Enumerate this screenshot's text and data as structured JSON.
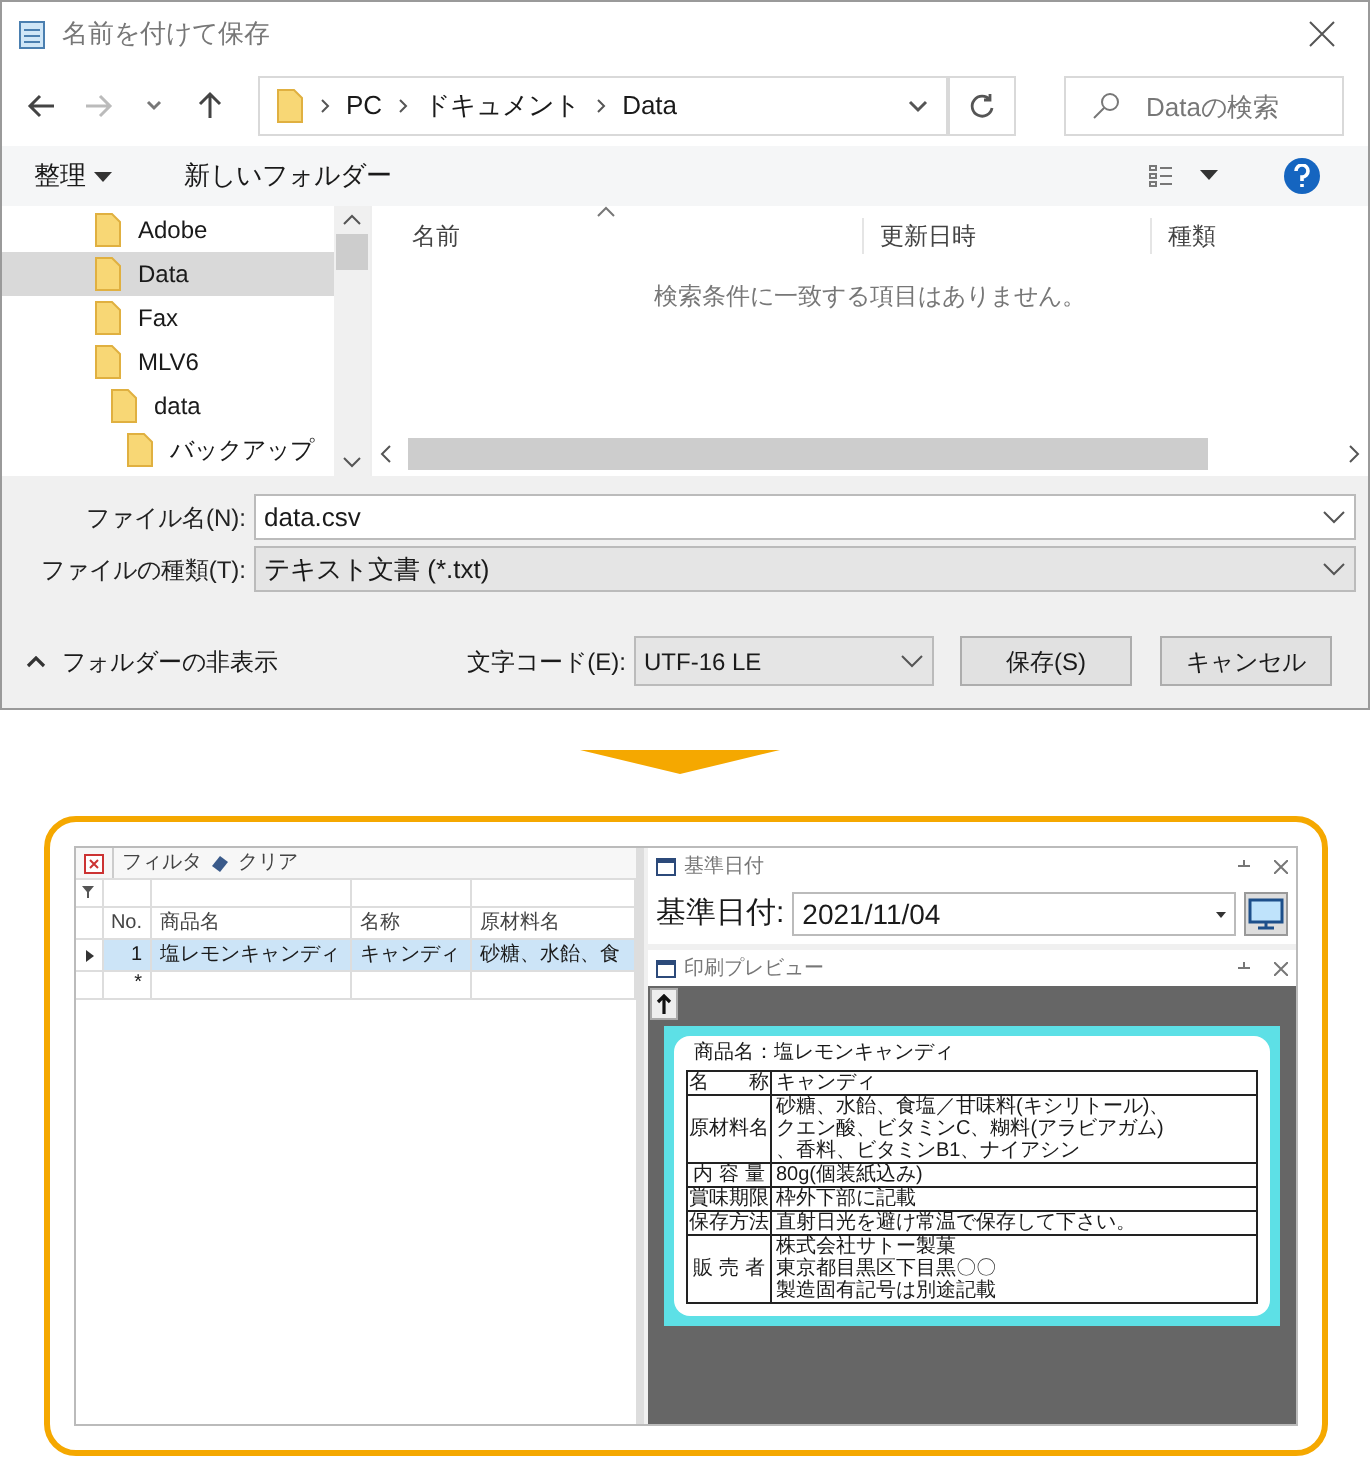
{
  "dialog": {
    "title": "名前を付けて保存",
    "breadcrumb": [
      "PC",
      "ドキュメント",
      "Data"
    ],
    "search": {
      "placeholder": "Dataの検索"
    },
    "toolbar": {
      "organize": "整理",
      "new_folder": "新しいフォルダー"
    },
    "folders": [
      {
        "name": "Adobe",
        "selected": false
      },
      {
        "name": "Data",
        "selected": true
      },
      {
        "name": "Fax",
        "selected": false
      },
      {
        "name": "MLV6",
        "selected": false,
        "children": [
          {
            "name": "data",
            "selected": false,
            "children": [
              {
                "name": "バックアップ",
                "selected": false
              }
            ]
          }
        ]
      }
    ],
    "columns": [
      "名前",
      "更新日時",
      "種類"
    ],
    "empty_message": "検索条件に一致する項目はありません。",
    "file_name": {
      "label": "ファイル名(N):",
      "value": "data.csv"
    },
    "file_type": {
      "label": "ファイルの種類(T):",
      "value": "テキスト文書 (*.txt)"
    },
    "hide_folders": "フォルダーの非表示",
    "encoding": {
      "label": "文字コード(E):",
      "value": "UTF-16 LE"
    },
    "buttons": [
      "保存(S)",
      "キャンセル"
    ]
  },
  "app": {
    "grid": {
      "toolbar": [
        "フィルタ",
        "クリア"
      ],
      "columns": [
        "No.",
        "商品名",
        "名称",
        "原材料名"
      ],
      "rows": [
        {
          "selected": true,
          "cells": [
            "1",
            "塩レモンキャンディ",
            "キャンディ",
            "砂糖、水飴、食"
          ]
        }
      ],
      "new_row_marker": "*"
    },
    "date_panel": {
      "title": "基準日付",
      "label": "基準日付:",
      "value": "2021/11/04"
    },
    "preview": {
      "title": "印刷プレビュー",
      "label": {
        "product": "商品名：塩レモンキャンディ",
        "rows": [
          {
            "header": "名　　称",
            "lines": [
              "キャンディ"
            ]
          },
          {
            "header": "原材料名",
            "lines": [
              "砂糖、水飴、食塩／甘味料(キシリトール)、",
              "クエン酸、ビタミンC、糊料(アラビアガム)",
              "、香料、ビタミンB1、ナイアシン"
            ]
          },
          {
            "header": "内 容 量",
            "lines": [
              "80g(個装紙込み)"
            ]
          },
          {
            "header": "賞味期限",
            "lines": [
              "枠外下部に記載"
            ]
          },
          {
            "header": "保存方法",
            "lines": [
              "直射日光を避け常温で保存して下さい。"
            ]
          },
          {
            "header": "販 売 者",
            "lines": [
              "株式会社サトー製菓",
              "東京都目黒区下目黒〇〇",
              "製造固有記号は別途記載"
            ]
          }
        ]
      }
    }
  }
}
